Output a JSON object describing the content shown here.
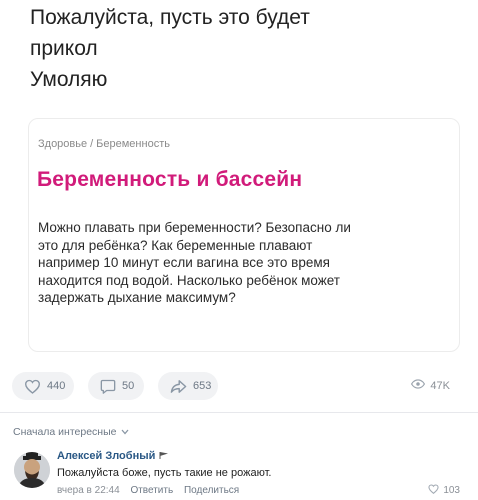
{
  "post": {
    "lines": [
      "Пожалуйста, пусть это будет",
      "прикол",
      "Умоляю"
    ]
  },
  "card": {
    "breadcrumbs": [
      "Здоровье",
      "Беременность"
    ],
    "separator": "/",
    "title": "Беременность и бассейн",
    "body_lines": [
      "Можно плавать при беременности? Безопасно ли",
      "это для ребёнка? Как беременные плавают",
      "например 10 минут если вагина все это время",
      "находится под водой. Насколько ребёнок может",
      "задержать дыхание максимум?"
    ],
    "accent_color": "#d11b7a"
  },
  "actions": {
    "likes": "440",
    "comments": "50",
    "shares": "653",
    "views": "47K"
  },
  "comments": {
    "sort_label": "Сначала интересные",
    "items": [
      {
        "author": "Алексей Злобный",
        "text": "Пожалуйста боже, пусть такие не рожают.",
        "time": "вчера в 22:44",
        "reply_label": "Ответить",
        "share_label": "Поделиться",
        "likes": "103"
      }
    ]
  },
  "icons": [
    "heart-icon",
    "comment-icon",
    "share-icon",
    "eye-icon",
    "chevron-down-icon",
    "flag-icon"
  ]
}
